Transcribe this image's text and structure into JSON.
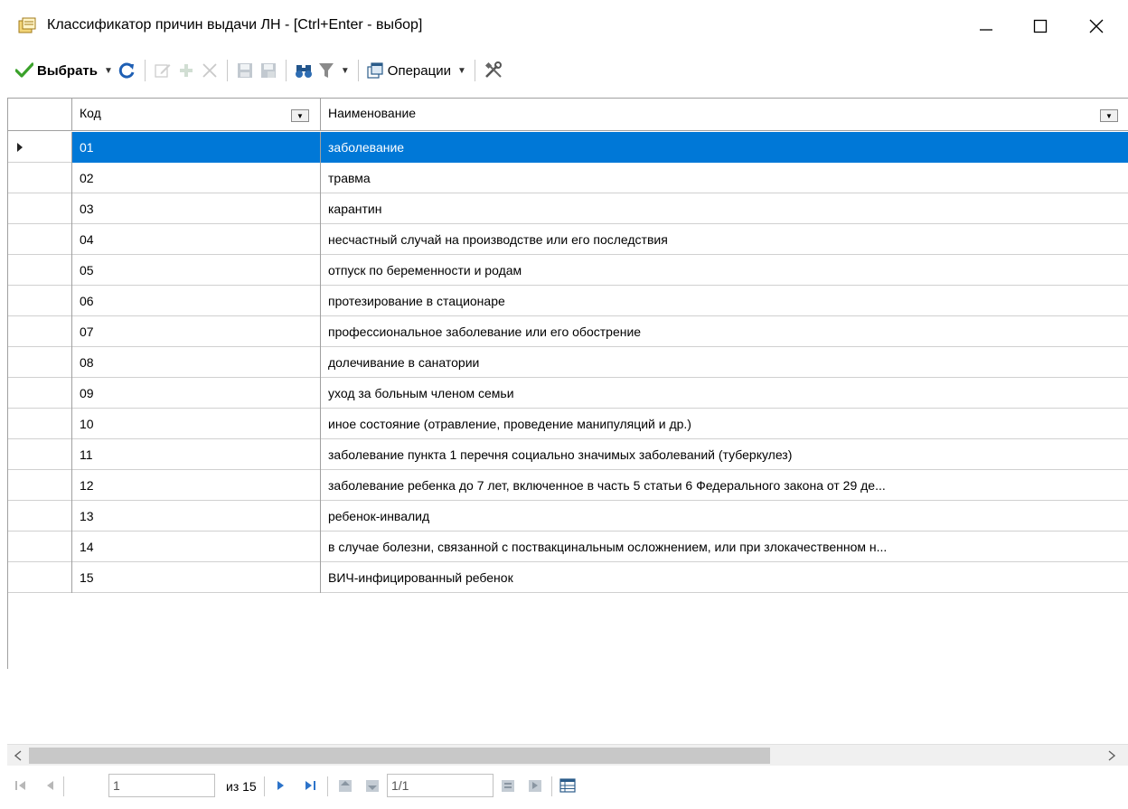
{
  "window": {
    "title": "Классификатор причин выдачи ЛН - [Ctrl+Enter - выбор]"
  },
  "toolbar": {
    "select_label": "Выбрать",
    "operations_label": "Операции"
  },
  "grid": {
    "columns": [
      "Код",
      "Наименование"
    ],
    "selected_index": 0,
    "rows": [
      {
        "code": "01",
        "name": "заболевание"
      },
      {
        "code": "02",
        "name": "травма"
      },
      {
        "code": "03",
        "name": "карантин"
      },
      {
        "code": "04",
        "name": "несчастный случай на производстве или его последствия"
      },
      {
        "code": "05",
        "name": "отпуск по беременности и родам"
      },
      {
        "code": "06",
        "name": "протезирование в стационаре"
      },
      {
        "code": "07",
        "name": "профессиональное заболевание или его обострение"
      },
      {
        "code": "08",
        "name": "долечивание в санатории"
      },
      {
        "code": "09",
        "name": "уход за больным членом семьи"
      },
      {
        "code": "10",
        "name": "иное состояние (отравление, проведение манипуляций и др.)"
      },
      {
        "code": "11",
        "name": "заболевание пункта 1 перечня социально значимых заболеваний (туберкулез)"
      },
      {
        "code": "12",
        "name": "заболевание ребенка до 7 лет, включенное в часть 5 статьи 6 Федерального закона от 29 де..."
      },
      {
        "code": "13",
        "name": "ребенок-инвалид"
      },
      {
        "code": "14",
        "name": "в случае болезни, связанной с поствакцинальным осложнением, или при злокачественном н..."
      },
      {
        "code": "15",
        "name": "ВИЧ-инфицированный ребенок"
      }
    ]
  },
  "navigator": {
    "record_value": "1",
    "of_total": "из 15",
    "page_value": "1/1"
  },
  "colors": {
    "selection": "#0078d7",
    "toolbar_check": "#3aa12a",
    "refresh": "#1e5fb4"
  }
}
